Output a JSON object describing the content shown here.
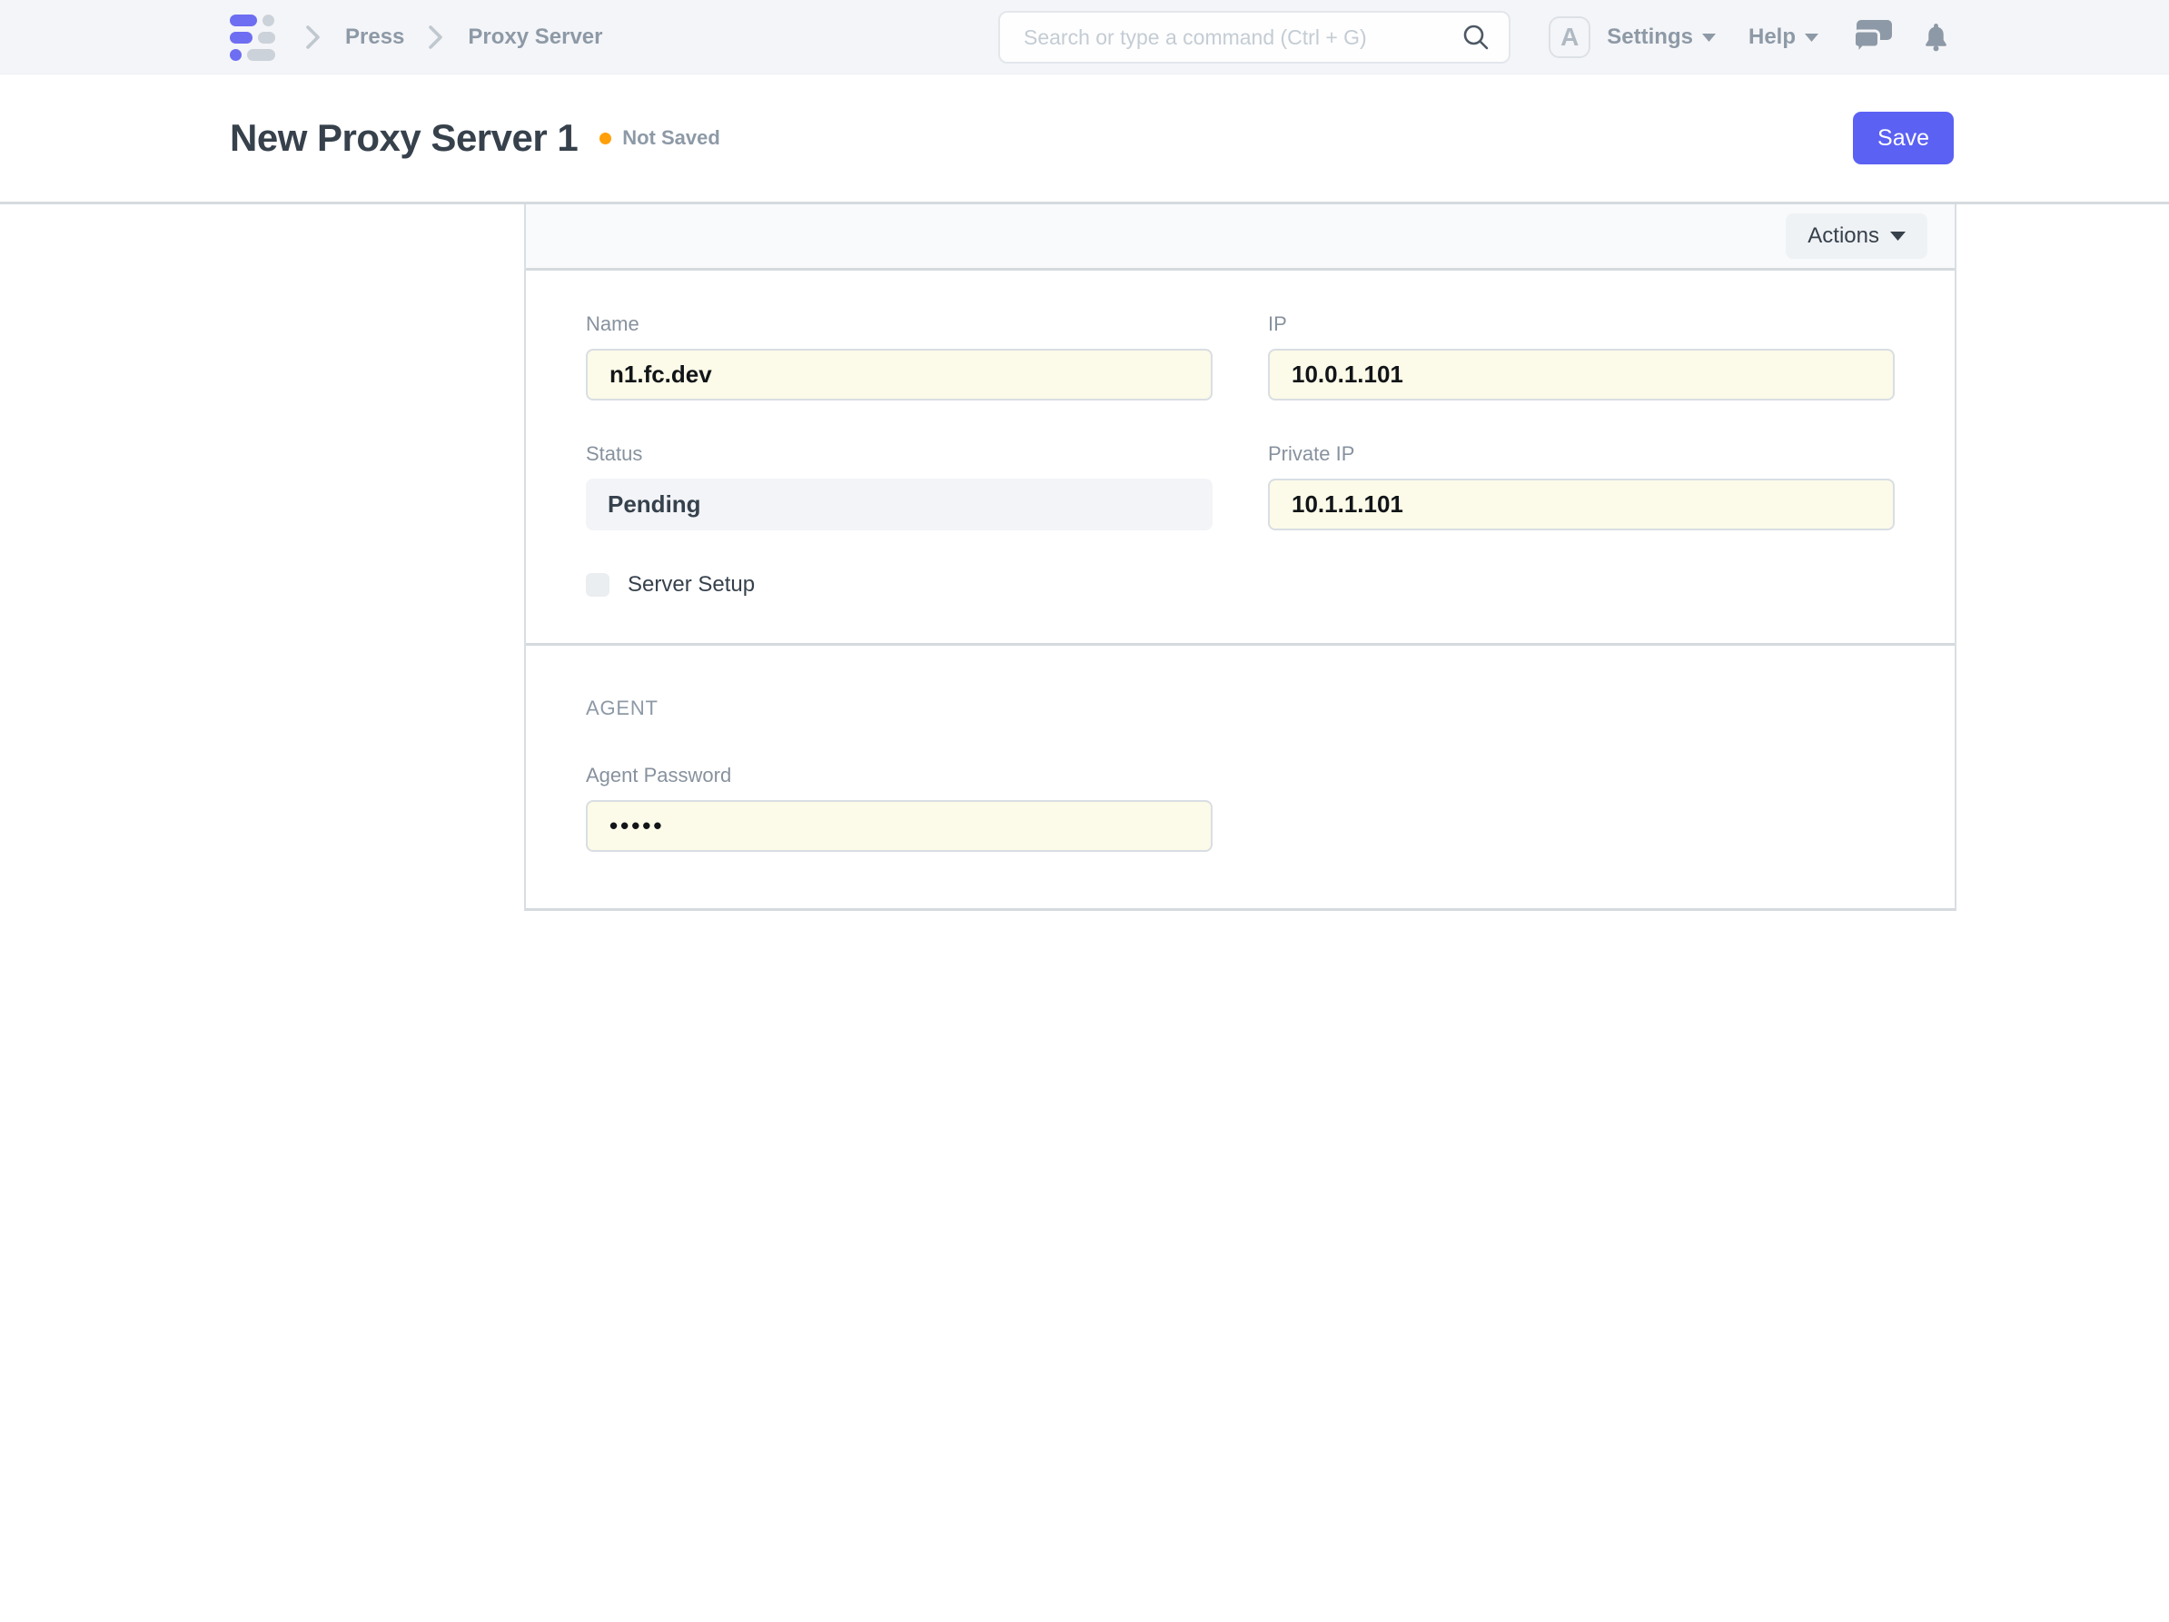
{
  "navbar": {
    "breadcrumbs": [
      {
        "label": "Press"
      },
      {
        "label": "Proxy Server"
      }
    ],
    "search": {
      "placeholder": "Search or type a command (Ctrl + G)"
    },
    "avatar_letter": "A",
    "settings_label": "Settings",
    "help_label": "Help"
  },
  "page_head": {
    "title": "New Proxy Server 1",
    "status_indicator": "Not Saved",
    "save_label": "Save"
  },
  "toolbar": {
    "actions_label": "Actions"
  },
  "form": {
    "sections": {
      "agent_heading": "AGENT"
    },
    "fields": {
      "name": {
        "label": "Name",
        "value": "n1.fc.dev"
      },
      "ip": {
        "label": "IP",
        "value": "10.0.1.101"
      },
      "status": {
        "label": "Status",
        "value": "Pending"
      },
      "private_ip": {
        "label": "Private IP",
        "value": "10.1.1.101"
      },
      "server_setup": {
        "label": "Server Setup",
        "checked": false
      },
      "agent_password": {
        "label": "Agent Password",
        "value": "•••••"
      }
    }
  },
  "colors": {
    "accent": "#5b61f3",
    "indicator_orange": "#ffa00a",
    "required_input_bg": "#fcfae8",
    "logo_indigo": "#6e6ef2",
    "logo_gray": "#ccd2d9",
    "text_dark": "#36414c",
    "text_muted": "#8d99a6",
    "navbar_bg": "#f4f5f8"
  }
}
